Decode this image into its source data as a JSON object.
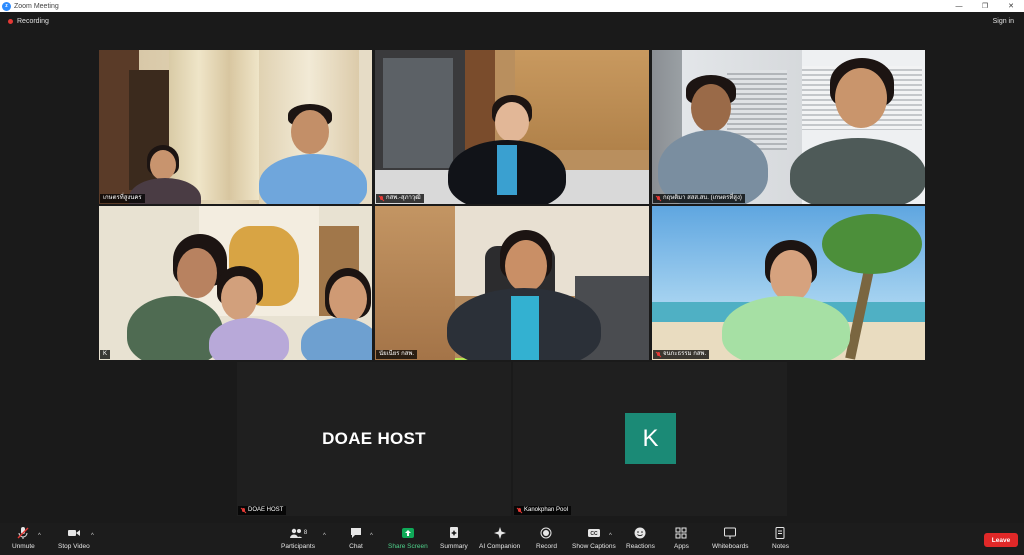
{
  "window": {
    "title": "Zoom Meeting",
    "icon": "zoom-logo"
  },
  "header": {
    "recording_label": "Recording",
    "signin_label": "Sign in"
  },
  "tiles": [
    {
      "name": "เกษตรที่สูงนคร"
    },
    {
      "name": "กสพ.-สุภาวุฒิ"
    },
    {
      "name": "กฤษติมา สสส.สบ. (เกษตรที่สูง)"
    },
    {
      "name": "K"
    },
    {
      "name": "นัยเนียร กสพ."
    },
    {
      "name": "จนกะธรรม กสพ."
    },
    {
      "name": "DOAE HOST",
      "center_text": "DOAE HOST"
    },
    {
      "name": "Kanokphan Pool",
      "avatar_letter": "K",
      "avatar_color": "#1b8a76"
    }
  ],
  "toolbar": {
    "unmute": "Unmute",
    "stop_video": "Stop Video",
    "participants": "Participants",
    "participants_count": "8",
    "chat": "Chat",
    "share_screen": "Share Screen",
    "summary": "Summary",
    "ai_companion": "AI Companion",
    "record": "Record",
    "show_captions": "Show Captions",
    "reactions": "Reactions",
    "apps": "Apps",
    "whiteboards": "Whiteboards",
    "notes": "Notes",
    "leave": "Leave"
  },
  "colors": {
    "active_speaker": "#b5e853",
    "leave": "#e02828",
    "share": "#0fa958",
    "recording": "#e53935"
  }
}
